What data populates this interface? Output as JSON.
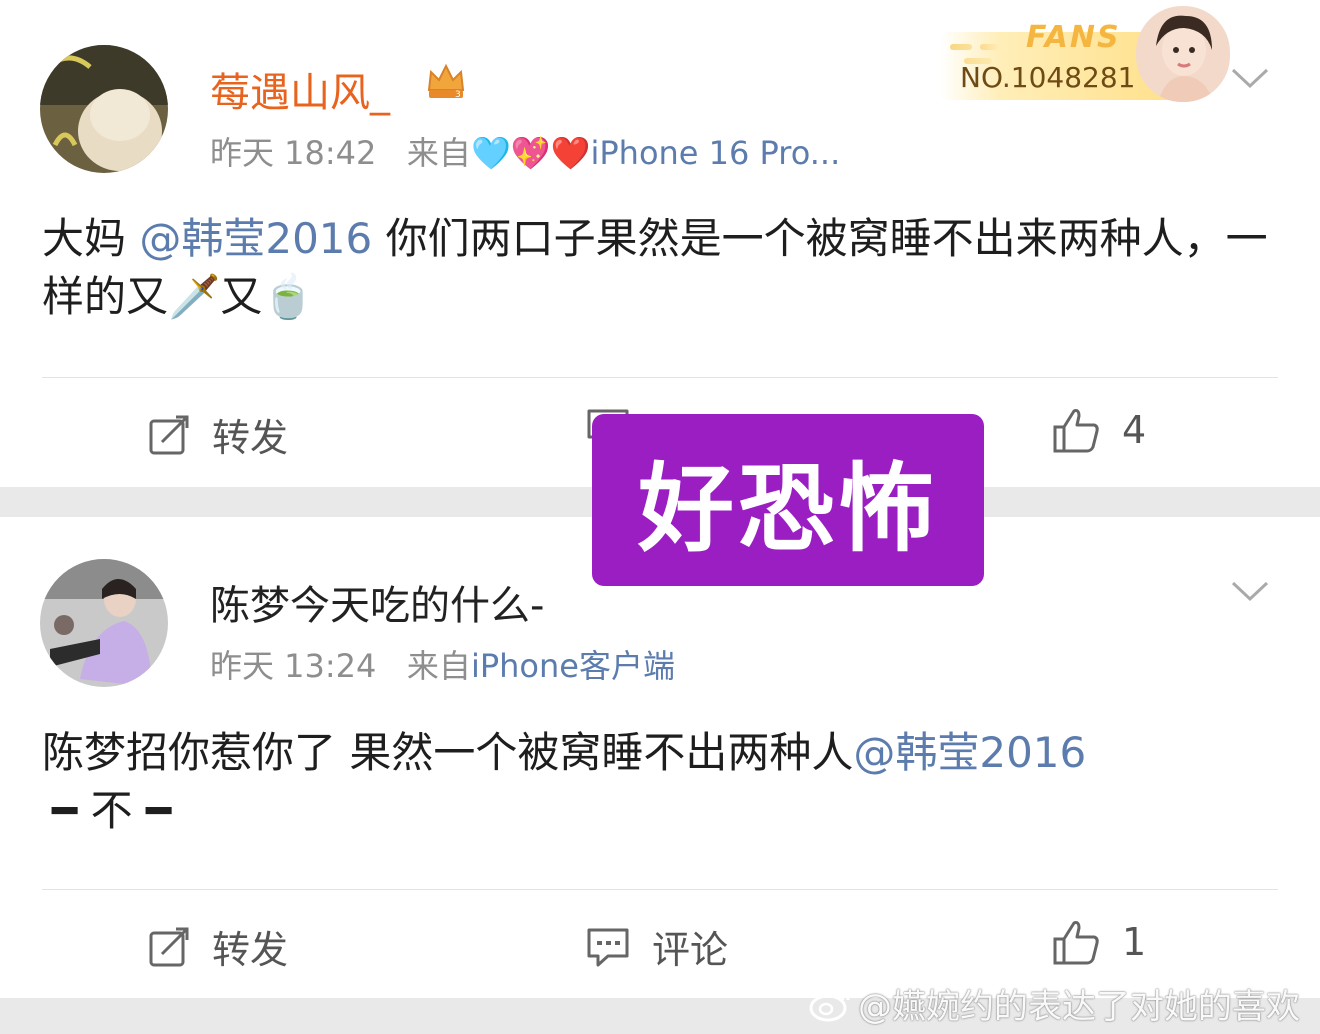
{
  "comments": [
    {
      "username": "莓遇山风_",
      "time": "昨天 18:42",
      "source_prefix": "来自",
      "source_emoji": "🩵💖❤️",
      "source_device": "iPhone 16 Pro...",
      "text_before": "大妈 ",
      "mention": "@韩莹2016",
      "text_after": " 你们两口子果然是一个被窝睡不出来两种人，一样的又🗡️又🍵",
      "repost_label": "转发",
      "like_count": "4"
    },
    {
      "username": "陈梦今天吃的什么-",
      "time": "昨天 13:24",
      "source_prefix": "来自",
      "source_device": "iPhone客户端",
      "text_before": "陈梦招你惹你了 果然一个被窝睡不出两种人",
      "mention": "@韩莹2016",
      "text_line2": "━ 不 ━",
      "repost_label": "转发",
      "comment_label": "评论",
      "like_count": "1"
    }
  ],
  "fans_badge": {
    "word": "FANS",
    "number": "NO.1048281"
  },
  "sticker_text": "好恐怖",
  "watermark": "@嬿婉约的表达了对她的喜欢",
  "colors": {
    "username_orange": "#e8641e",
    "mention_blue": "#5b7cad",
    "sticker_purple": "#9a1ec2"
  }
}
